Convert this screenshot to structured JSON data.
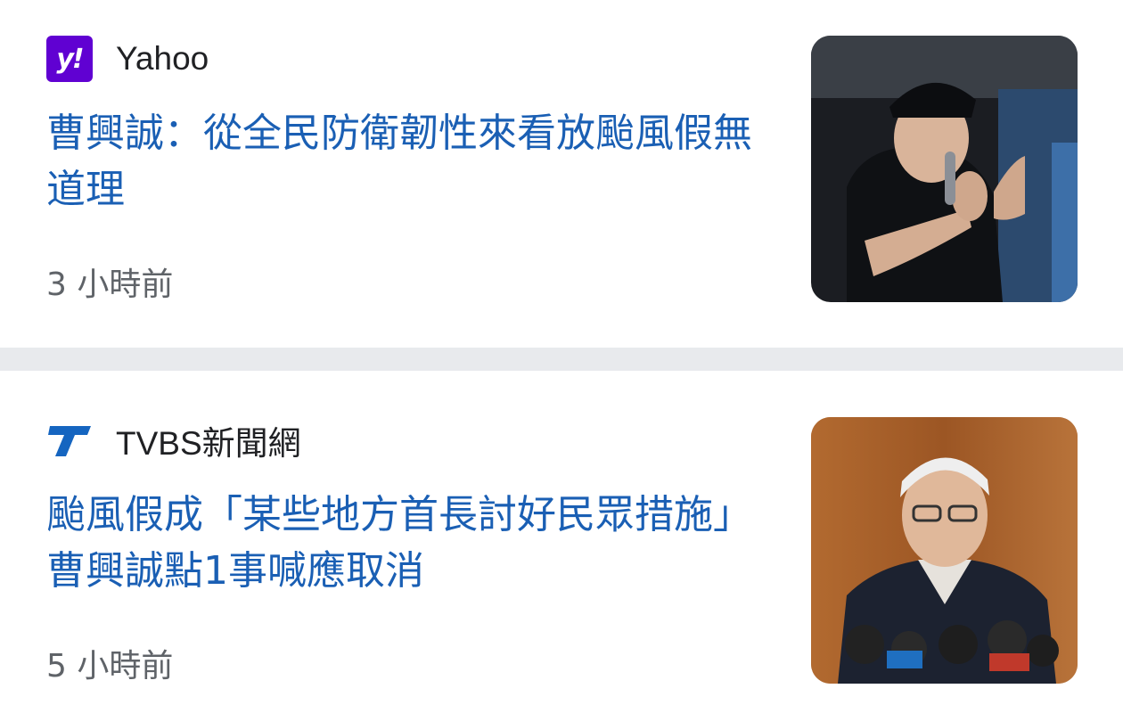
{
  "articles": [
    {
      "source": "Yahoo",
      "source_logo_icon": "yahoo-logo-icon",
      "headline": "曹興誠：從全民防衛韌性來看放颱風假無道理",
      "time": "3 小時前",
      "accent_color": "#1a5fb4"
    },
    {
      "source": "TVBS新聞網",
      "source_logo_icon": "tvbs-logo-icon",
      "headline": "颱風假成「某些地方首長討好民眾措施」 曹興誠點1事喊應取消",
      "time": "5 小時前",
      "accent_color": "#1a5fb4"
    }
  ]
}
